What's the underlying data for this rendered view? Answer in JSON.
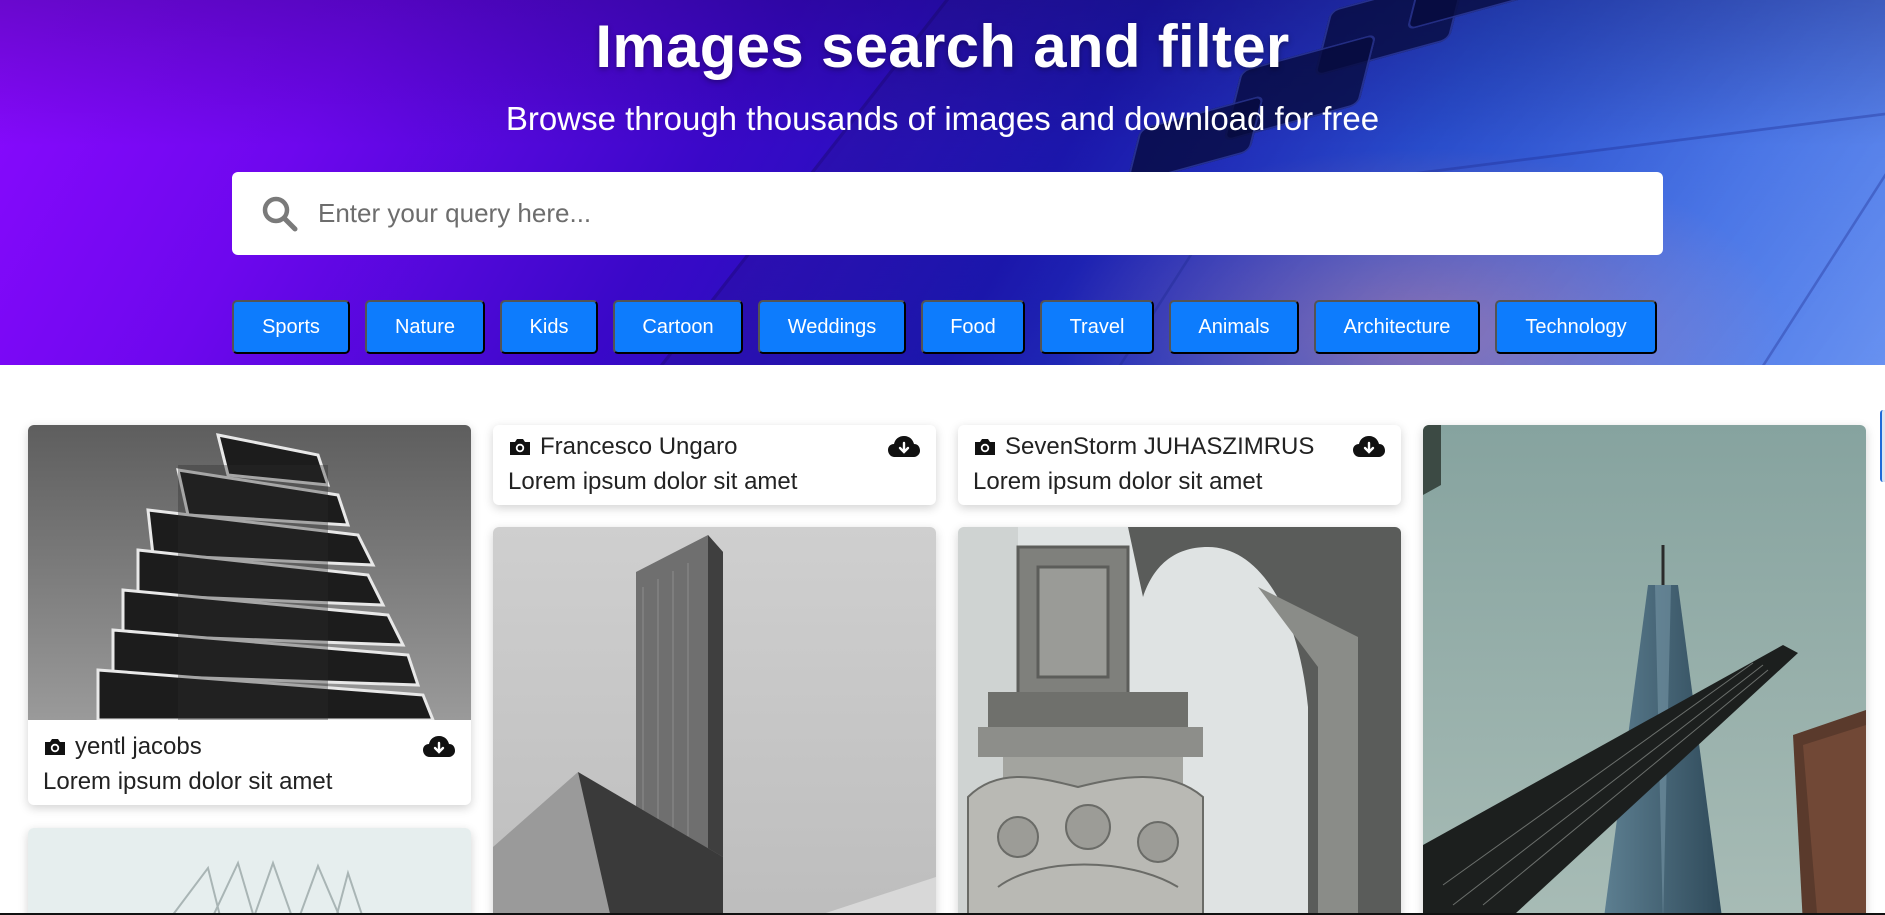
{
  "hero": {
    "title": "Images search and filter",
    "subtitle": "Browse through thousands of images and download for free",
    "search_placeholder": "Enter your query here...",
    "search_value": ""
  },
  "tags": [
    "Sports",
    "Nature",
    "Kids",
    "Cartoon",
    "Weddings",
    "Food",
    "Travel",
    "Animals",
    "Architecture",
    "Technology"
  ],
  "cards": [
    {
      "author": "yentl jacobs",
      "caption": "Lorem ipsum dolor sit amet"
    },
    {
      "author": "Francesco Ungaro",
      "caption": "Lorem ipsum dolor sit amet"
    },
    {
      "author": "SevenStorm JUHASZIMRUS",
      "caption": "Lorem ipsum dolor sit amet"
    }
  ],
  "icons": {
    "search": "search-icon",
    "camera": "camera-icon",
    "download": "cloud-download-icon"
  },
  "colors": {
    "tag_bg": "#0d7cfd",
    "hero_start": "#8a0aff",
    "hero_end": "#6a95f4"
  }
}
